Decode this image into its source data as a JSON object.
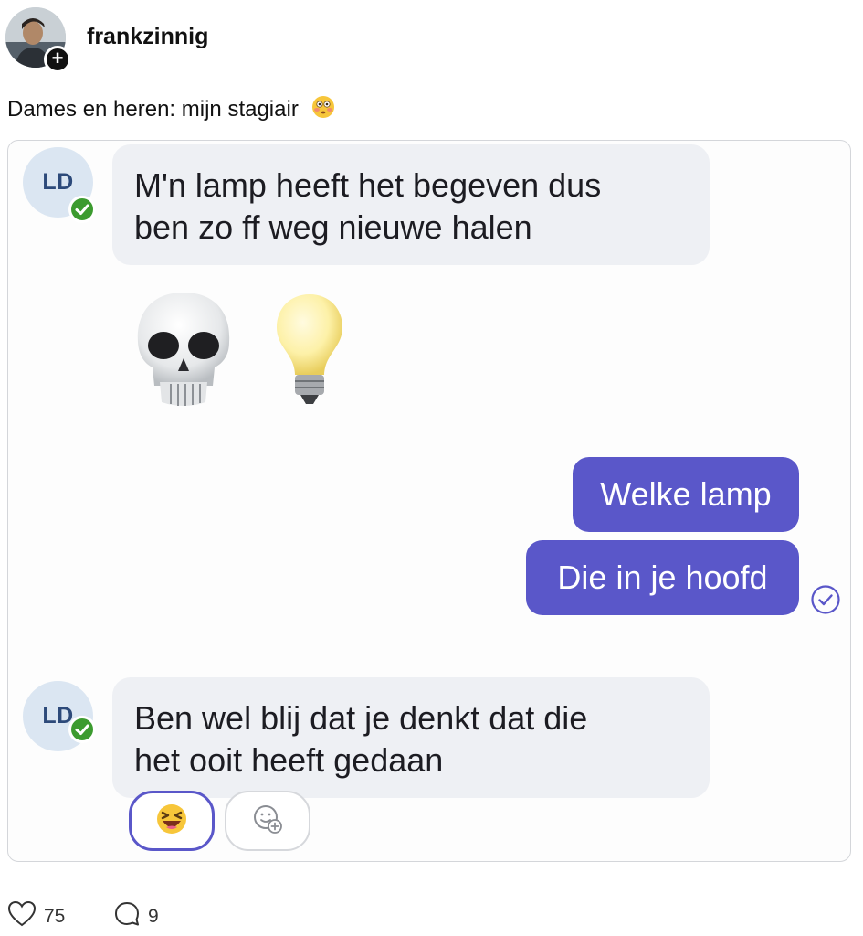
{
  "post": {
    "username": "frankzinnig",
    "text": "Dames en heren: mijn stagiair",
    "text_emoji": "flushed-face",
    "likes": "75",
    "comments": "9"
  },
  "chat": {
    "contact_initials": "LD",
    "messages": [
      {
        "from": "them",
        "text_line1": "M'n lamp heeft het begeven dus",
        "text_line2": "ben zo ff weg nieuwe halen"
      },
      {
        "from": "them",
        "emojis": [
          "skull",
          "light-bulb"
        ]
      },
      {
        "from": "me",
        "text": "Welke lamp"
      },
      {
        "from": "me",
        "text": "Die in je hoofd",
        "status": "read-check"
      },
      {
        "from": "them",
        "text_line1": "Ben wel blij dat je denkt dat die",
        "text_line2": "het ooit heeft gedaan",
        "reactions": [
          "squinting-laughing-face",
          "add-reaction"
        ]
      }
    ]
  },
  "colors": {
    "outgoing_bubble": "#5a57c9",
    "incoming_bubble": "#eef0f4",
    "verified_badge": "#3c9b2f",
    "avatar_bg": "#dbe6f2"
  }
}
